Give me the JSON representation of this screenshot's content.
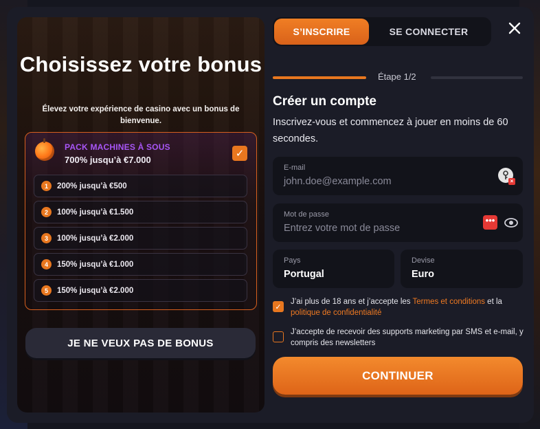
{
  "left_panel": {
    "title": "Choisissez votre bonus",
    "subtitle": "Élevez votre expérience de casino avec un bonus de bienvenue.",
    "selected_bonus": {
      "name": "PACK MACHINES À SOUS",
      "value": "700% jusqu’à €7.000",
      "icon": "orange-fruit-icon",
      "checkmark": "✓"
    },
    "bonus_items": [
      {
        "number": "1",
        "label": "200% jusqu’à €500"
      },
      {
        "number": "2",
        "label": "100% jusqu’à €1.500"
      },
      {
        "number": "3",
        "label": "100% jusqu’à €2.000"
      },
      {
        "number": "4",
        "label": "150% jusqu’à €1.000"
      },
      {
        "number": "5",
        "label": "150% jusqu’à €2.000"
      }
    ],
    "no_bonus_label": "JE NE VEUX PAS DE BONUS"
  },
  "tabs": {
    "register": "S’INSCRIRE",
    "login": "SE CONNECTER",
    "active": "register"
  },
  "step": {
    "label": "Étape 1/2",
    "current": 1,
    "total": 2
  },
  "form": {
    "title": "Créer un compte",
    "description": "Inscrivez-vous et commencez à jouer en moins de 60 secondes.",
    "email": {
      "label": "E-mail",
      "placeholder": "john.doe@example.com"
    },
    "password": {
      "label": "Mot de passe",
      "placeholder": "Entrez votre mot de passe",
      "dots_label": "•••"
    },
    "country": {
      "label": "Pays",
      "value": "Portugal"
    },
    "currency": {
      "label": "Devise",
      "value": "Euro"
    },
    "terms": {
      "checked": true,
      "checkmark": "✓",
      "text_before": "J’ai plus de 18 ans et j’accepte les ",
      "link_terms": "Termes et conditions",
      "text_middle": " et la ",
      "link_privacy": "politique de confidentialité"
    },
    "marketing": {
      "checked": false,
      "text": "J’accepte de recevoir des supports marketing par SMS et e-mail, y compris des newsletters"
    },
    "continue_label": "CONTINUER"
  },
  "colors": {
    "accent": "#e8771f",
    "modal_bg": "#1b1c27",
    "field_bg": "#12131a",
    "bonus_name": "#a855f7"
  }
}
